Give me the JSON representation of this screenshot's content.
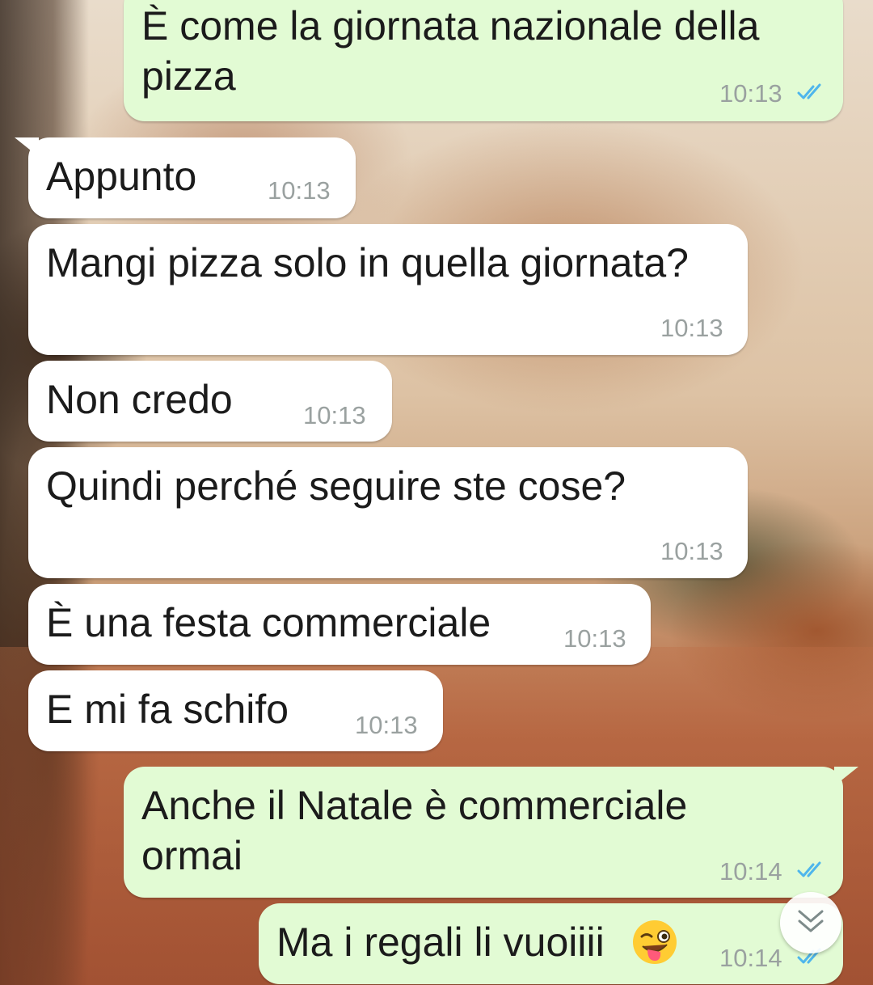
{
  "chat": {
    "messages": [
      {
        "direction": "outgoing",
        "text": "È come la giornata nazionale della\npizza",
        "time": "10:13",
        "status": "read"
      },
      {
        "direction": "incoming",
        "text": "Appunto",
        "time": "10:13"
      },
      {
        "direction": "incoming",
        "text": "Mangi pizza solo in quella giornata?",
        "time": "10:13"
      },
      {
        "direction": "incoming",
        "text": "Non credo",
        "time": "10:13"
      },
      {
        "direction": "incoming",
        "text": "Quindi perché seguire ste cose?",
        "time": "10:13"
      },
      {
        "direction": "incoming",
        "text": "È una festa commerciale",
        "time": "10:13"
      },
      {
        "direction": "incoming",
        "text": "E mi fa schifo",
        "time": "10:13"
      },
      {
        "direction": "outgoing",
        "text": "Anche il Natale è commerciale\normai",
        "time": "10:14",
        "status": "read"
      },
      {
        "direction": "outgoing",
        "text": "Ma i regali li vuoiiii",
        "emoji": "winking-face-with-tongue",
        "time": "10:14",
        "status": "read"
      }
    ],
    "scroll_down_icon": "double-chevron-down-icon"
  },
  "colors": {
    "outgoing_bubble": "#e2fbd4",
    "incoming_bubble": "#ffffff",
    "read_ticks": "#4fb6ec",
    "timestamp": "#9aa1a0"
  }
}
